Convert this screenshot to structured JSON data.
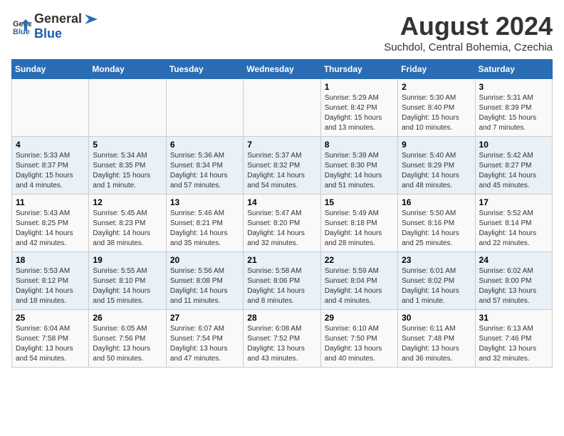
{
  "header": {
    "logo_general": "General",
    "logo_blue": "Blue",
    "title": "August 2024",
    "subtitle": "Suchdol, Central Bohemia, Czechia"
  },
  "weekdays": [
    "Sunday",
    "Monday",
    "Tuesday",
    "Wednesday",
    "Thursday",
    "Friday",
    "Saturday"
  ],
  "weeks": [
    [
      {
        "day": "",
        "info": ""
      },
      {
        "day": "",
        "info": ""
      },
      {
        "day": "",
        "info": ""
      },
      {
        "day": "",
        "info": ""
      },
      {
        "day": "1",
        "info": "Sunrise: 5:29 AM\nSunset: 8:42 PM\nDaylight: 15 hours\nand 13 minutes."
      },
      {
        "day": "2",
        "info": "Sunrise: 5:30 AM\nSunset: 8:40 PM\nDaylight: 15 hours\nand 10 minutes."
      },
      {
        "day": "3",
        "info": "Sunrise: 5:31 AM\nSunset: 8:39 PM\nDaylight: 15 hours\nand 7 minutes."
      }
    ],
    [
      {
        "day": "4",
        "info": "Sunrise: 5:33 AM\nSunset: 8:37 PM\nDaylight: 15 hours\nand 4 minutes."
      },
      {
        "day": "5",
        "info": "Sunrise: 5:34 AM\nSunset: 8:35 PM\nDaylight: 15 hours\nand 1 minute."
      },
      {
        "day": "6",
        "info": "Sunrise: 5:36 AM\nSunset: 8:34 PM\nDaylight: 14 hours\nand 57 minutes."
      },
      {
        "day": "7",
        "info": "Sunrise: 5:37 AM\nSunset: 8:32 PM\nDaylight: 14 hours\nand 54 minutes."
      },
      {
        "day": "8",
        "info": "Sunrise: 5:39 AM\nSunset: 8:30 PM\nDaylight: 14 hours\nand 51 minutes."
      },
      {
        "day": "9",
        "info": "Sunrise: 5:40 AM\nSunset: 8:29 PM\nDaylight: 14 hours\nand 48 minutes."
      },
      {
        "day": "10",
        "info": "Sunrise: 5:42 AM\nSunset: 8:27 PM\nDaylight: 14 hours\nand 45 minutes."
      }
    ],
    [
      {
        "day": "11",
        "info": "Sunrise: 5:43 AM\nSunset: 8:25 PM\nDaylight: 14 hours\nand 42 minutes."
      },
      {
        "day": "12",
        "info": "Sunrise: 5:45 AM\nSunset: 8:23 PM\nDaylight: 14 hours\nand 38 minutes."
      },
      {
        "day": "13",
        "info": "Sunrise: 5:46 AM\nSunset: 8:21 PM\nDaylight: 14 hours\nand 35 minutes."
      },
      {
        "day": "14",
        "info": "Sunrise: 5:47 AM\nSunset: 8:20 PM\nDaylight: 14 hours\nand 32 minutes."
      },
      {
        "day": "15",
        "info": "Sunrise: 5:49 AM\nSunset: 8:18 PM\nDaylight: 14 hours\nand 28 minutes."
      },
      {
        "day": "16",
        "info": "Sunrise: 5:50 AM\nSunset: 8:16 PM\nDaylight: 14 hours\nand 25 minutes."
      },
      {
        "day": "17",
        "info": "Sunrise: 5:52 AM\nSunset: 8:14 PM\nDaylight: 14 hours\nand 22 minutes."
      }
    ],
    [
      {
        "day": "18",
        "info": "Sunrise: 5:53 AM\nSunset: 8:12 PM\nDaylight: 14 hours\nand 18 minutes."
      },
      {
        "day": "19",
        "info": "Sunrise: 5:55 AM\nSunset: 8:10 PM\nDaylight: 14 hours\nand 15 minutes."
      },
      {
        "day": "20",
        "info": "Sunrise: 5:56 AM\nSunset: 8:08 PM\nDaylight: 14 hours\nand 11 minutes."
      },
      {
        "day": "21",
        "info": "Sunrise: 5:58 AM\nSunset: 8:06 PM\nDaylight: 14 hours\nand 8 minutes."
      },
      {
        "day": "22",
        "info": "Sunrise: 5:59 AM\nSunset: 8:04 PM\nDaylight: 14 hours\nand 4 minutes."
      },
      {
        "day": "23",
        "info": "Sunrise: 6:01 AM\nSunset: 8:02 PM\nDaylight: 14 hours\nand 1 minute."
      },
      {
        "day": "24",
        "info": "Sunrise: 6:02 AM\nSunset: 8:00 PM\nDaylight: 13 hours\nand 57 minutes."
      }
    ],
    [
      {
        "day": "25",
        "info": "Sunrise: 6:04 AM\nSunset: 7:58 PM\nDaylight: 13 hours\nand 54 minutes."
      },
      {
        "day": "26",
        "info": "Sunrise: 6:05 AM\nSunset: 7:56 PM\nDaylight: 13 hours\nand 50 minutes."
      },
      {
        "day": "27",
        "info": "Sunrise: 6:07 AM\nSunset: 7:54 PM\nDaylight: 13 hours\nand 47 minutes."
      },
      {
        "day": "28",
        "info": "Sunrise: 6:08 AM\nSunset: 7:52 PM\nDaylight: 13 hours\nand 43 minutes."
      },
      {
        "day": "29",
        "info": "Sunrise: 6:10 AM\nSunset: 7:50 PM\nDaylight: 13 hours\nand 40 minutes."
      },
      {
        "day": "30",
        "info": "Sunrise: 6:11 AM\nSunset: 7:48 PM\nDaylight: 13 hours\nand 36 minutes."
      },
      {
        "day": "31",
        "info": "Sunrise: 6:13 AM\nSunset: 7:46 PM\nDaylight: 13 hours\nand 32 minutes."
      }
    ]
  ]
}
